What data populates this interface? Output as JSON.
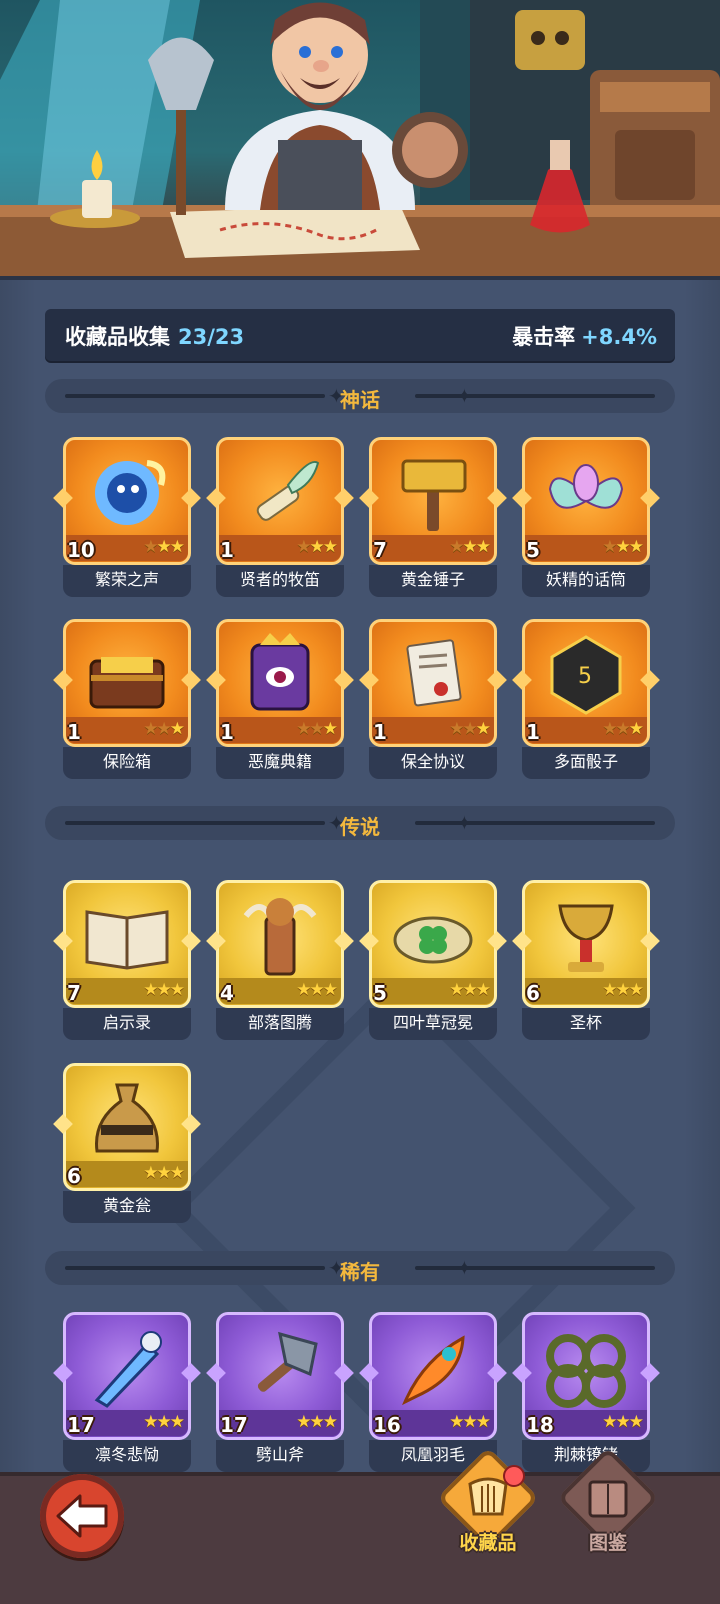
{
  "summary": {
    "collection_label": "收藏品收集",
    "collection_count": "23/23",
    "crit_label": "暴击率",
    "crit_value": "+8.4%"
  },
  "sections": {
    "mythic": "神话",
    "legendary": "传说",
    "rare": "稀有"
  },
  "mythic_items": [
    {
      "name": "繁荣之声",
      "qty": "10",
      "stars": 2,
      "icon": "prosperity-voice-icon"
    },
    {
      "name": "贤者的牧笛",
      "qty": "1",
      "stars": 2,
      "icon": "sage-flute-icon"
    },
    {
      "name": "黄金锤子",
      "qty": "7",
      "stars": 2,
      "icon": "golden-hammer-icon"
    },
    {
      "name": "妖精的话筒",
      "qty": "5",
      "stars": 2,
      "icon": "fairy-microphone-icon"
    },
    {
      "name": "保险箱",
      "qty": "1",
      "stars": 1,
      "icon": "treasure-chest-icon"
    },
    {
      "name": "恶魔典籍",
      "qty": "1",
      "stars": 1,
      "icon": "demon-tome-icon"
    },
    {
      "name": "保全协议",
      "qty": "1",
      "stars": 1,
      "icon": "security-agreement-icon"
    },
    {
      "name": "多面骰子",
      "qty": "1",
      "stars": 1,
      "icon": "polyhedral-dice-icon"
    }
  ],
  "legendary_items": [
    {
      "name": "启示录",
      "qty": "7",
      "stars": 3,
      "icon": "revelation-book-icon"
    },
    {
      "name": "部落图腾",
      "qty": "4",
      "stars": 3,
      "icon": "tribal-totem-icon"
    },
    {
      "name": "四叶草冠冕",
      "qty": "5",
      "stars": 3,
      "icon": "clover-crown-icon"
    },
    {
      "name": "圣杯",
      "qty": "6",
      "stars": 3,
      "icon": "holy-grail-icon"
    },
    {
      "name": "黄金瓮",
      "qty": "6",
      "stars": 3,
      "icon": "golden-urn-icon"
    }
  ],
  "rare_items": [
    {
      "name": "凛冬悲恸",
      "qty": "17",
      "stars": 3,
      "icon": "winter-sorrow-icon"
    },
    {
      "name": "劈山斧",
      "qty": "17",
      "stars": 3,
      "icon": "mountain-axe-icon"
    },
    {
      "name": "凤凰羽毛",
      "qty": "16",
      "stars": 3,
      "icon": "phoenix-feather-icon"
    },
    {
      "name": "荆棘镣铐",
      "qty": "18",
      "stars": 3,
      "icon": "thorn-shackles-icon"
    }
  ],
  "tabs": {
    "collection": "收藏品",
    "codex": "图鉴"
  },
  "colors": {
    "mythic": "#f28b1e",
    "legendary": "#f1c63c",
    "rare": "#8e5bd6",
    "accent_blue": "#7fd6ff",
    "section_title": "#f3b83d"
  }
}
